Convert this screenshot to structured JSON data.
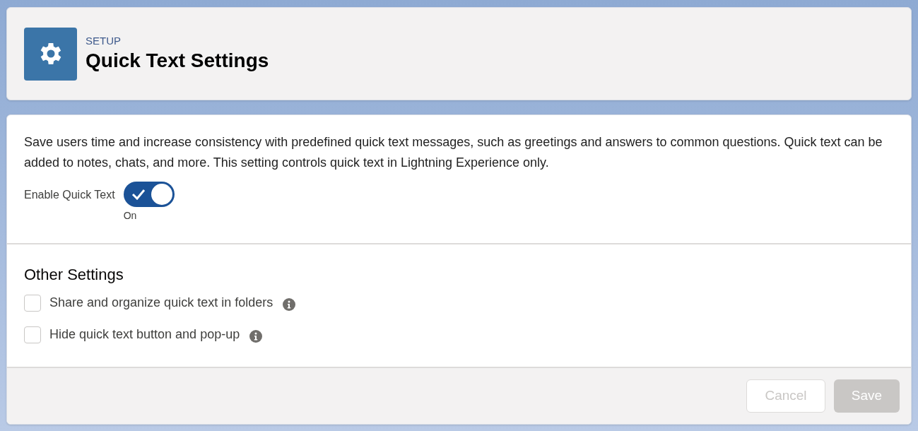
{
  "header": {
    "eyebrow": "SETUP",
    "title": "Quick Text Settings"
  },
  "description": "Save users time and increase consistency with predefined quick text messages, such as greetings and answers to common questions. Quick text can be added to notes, chats, and more. This setting controls quick text in Lightning Experience only.",
  "toggle": {
    "label": "Enable Quick Text",
    "on": true,
    "status": "On"
  },
  "other_settings": {
    "heading": "Other Settings",
    "options": [
      {
        "label": "Share and organize quick text in folders",
        "checked": false
      },
      {
        "label": "Hide quick text button and pop-up",
        "checked": false
      }
    ]
  },
  "buttons": [
    {
      "label": "Cancel",
      "kind": "neutral",
      "disabled": true
    },
    {
      "label": "Save",
      "kind": "brand",
      "disabled": true
    }
  ]
}
